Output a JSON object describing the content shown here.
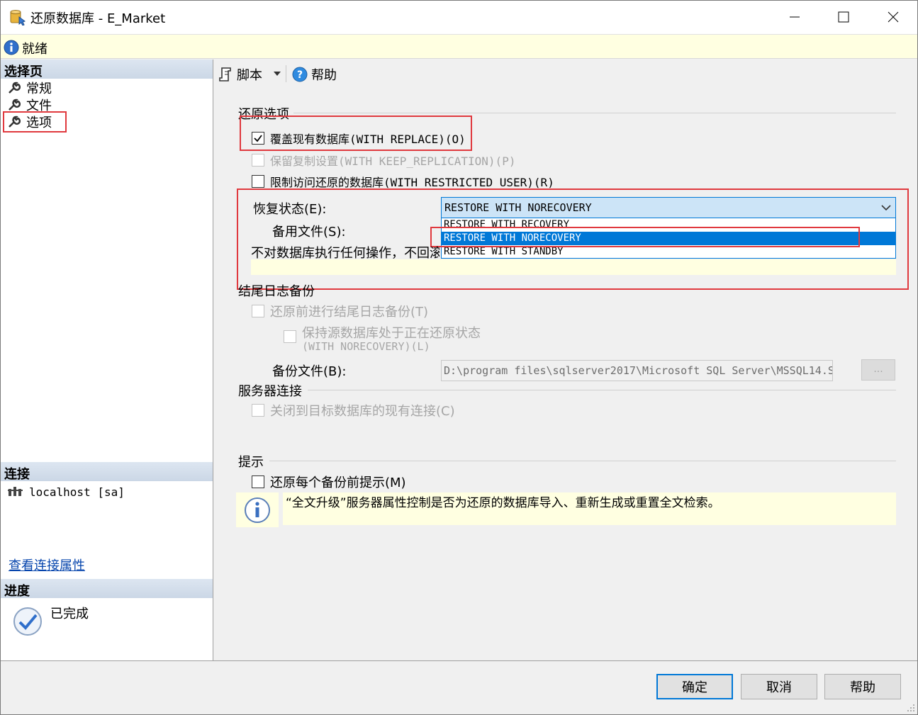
{
  "window": {
    "title": "还原数据库 - E_Market"
  },
  "status": {
    "text": "就绪"
  },
  "left": {
    "select_page_header": "选择页",
    "pages": [
      {
        "label": "常规"
      },
      {
        "label": "文件"
      },
      {
        "label": "选项"
      }
    ],
    "connection_header": "连接",
    "connection_value": "localhost [sa]",
    "view_connection_link": "查看连接属性",
    "progress_header": "进度",
    "progress_status": "已完成"
  },
  "toolbar": {
    "script_label": "脚本",
    "help_label": "帮助"
  },
  "restore_options": {
    "group_label": "还原选项",
    "overwrite_label": "覆盖现有数据库(WITH REPLACE)(O)",
    "overwrite_checked": true,
    "keep_replication_label": "保留复制设置(WITH KEEP_REPLICATION)(P)",
    "restricted_user_label": "限制访问还原的数据库(WITH RESTRICTED_USER)(R)",
    "recovery_state_label": "恢复状态(E):",
    "recovery_state_value": "RESTORE WITH NORECOVERY",
    "recovery_options": [
      "RESTORE WITH RECOVERY",
      "RESTORE WITH NORECOVERY",
      "RESTORE WITH STANDBY"
    ],
    "standby_file_label": "备用文件(S):",
    "description": "不对数据库执行任何操作，不回滚"
  },
  "tail_log": {
    "group_label": "结尾日志备份",
    "take_tail_label": "还原前进行结尾日志备份(T)",
    "leave_source_label_1": "保持源数据库处于正在还原状态",
    "leave_source_label_2": "(WITH NORECOVERY)(L)",
    "backup_file_label": "备份文件(B):",
    "backup_file_value": "D:\\program files\\sqlserver2017\\Microsoft SQL Server\\MSSQL14.S",
    "browse_label": "..."
  },
  "server_conn": {
    "group_label": "服务器连接",
    "close_conn_label": "关闭到目标数据库的现有连接(C)"
  },
  "prompt": {
    "group_label": "提示",
    "prompt_each_label": "还原每个备份前提示(M)",
    "info_text": "“全文升级”服务器属性控制是否为还原的数据库导入、重新生成或重置全文检索。"
  },
  "buttons": {
    "ok": "确定",
    "cancel": "取消",
    "help": "帮助"
  },
  "colors": {
    "accent": "#0078d7",
    "highlight_box": "#e0393e",
    "info_bg": "#ffffe1"
  }
}
